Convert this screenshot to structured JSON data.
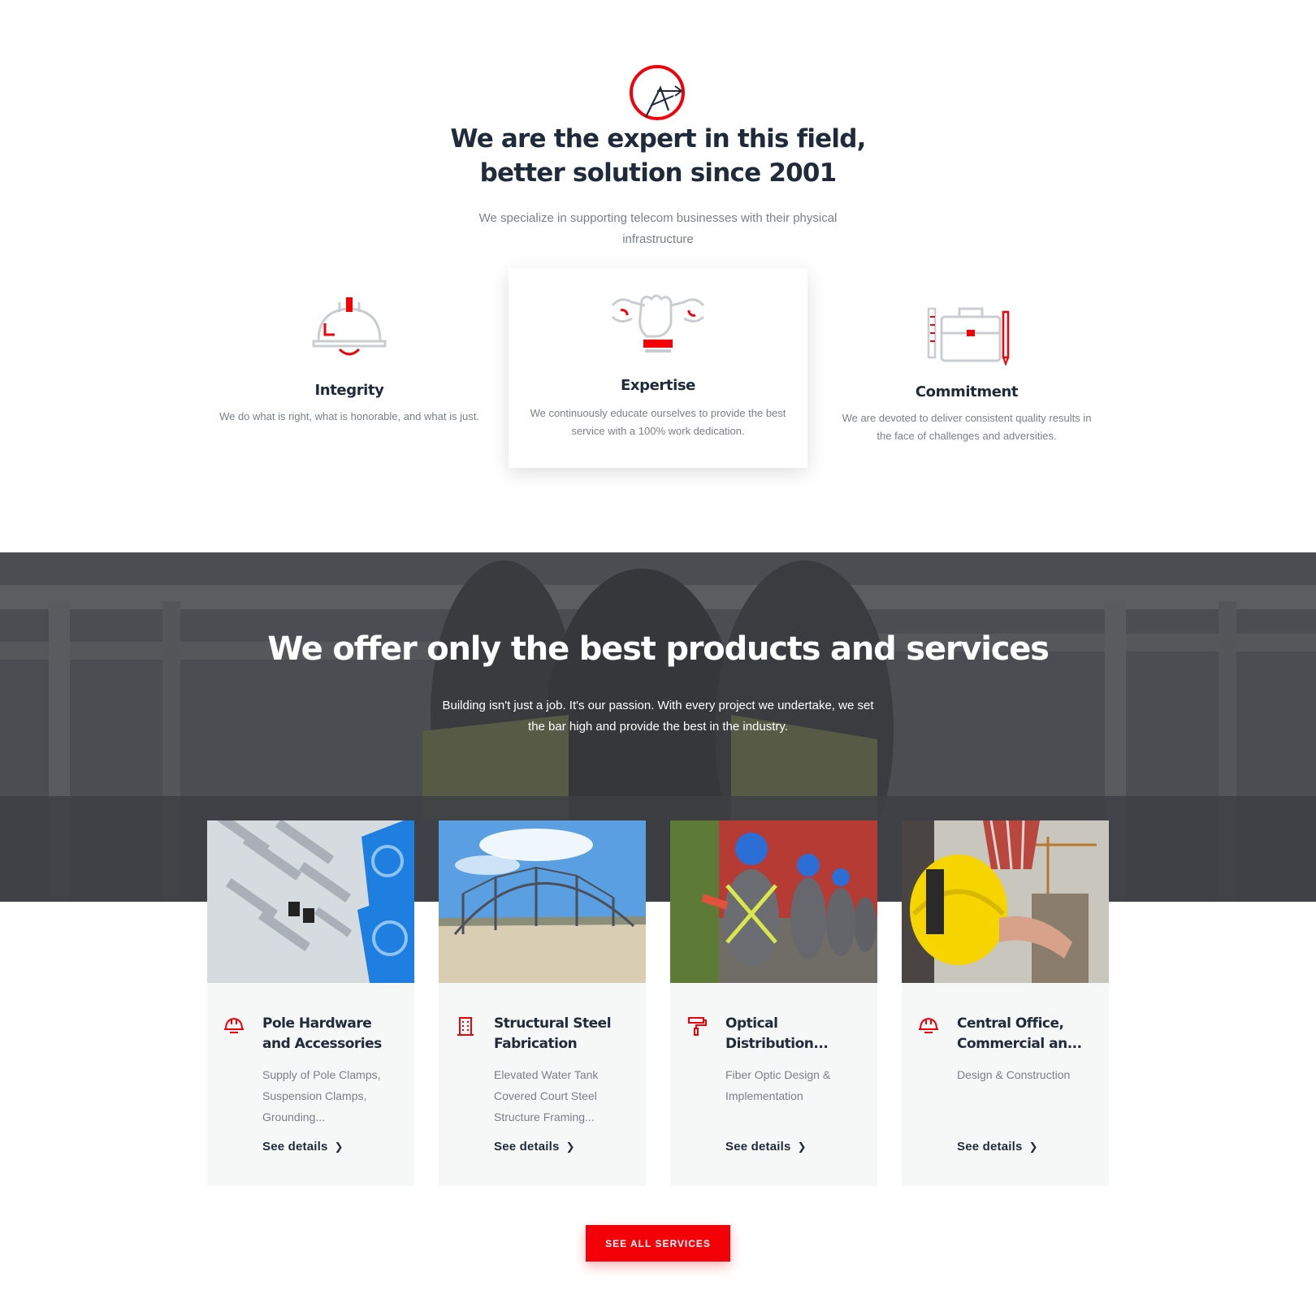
{
  "colors": {
    "accent": "#f40009",
    "heading": "#1f2b3a",
    "muted": "#7a7f87",
    "card_bg": "#f6f7f7"
  },
  "intro": {
    "headline_line1": "We are the expert in this field,",
    "headline_line2": "better solution since 2001",
    "text": "We specialize in supporting telecom businesses with their physical infrastructure"
  },
  "values": [
    {
      "icon": "hard-hat-icon",
      "title": "Integrity",
      "text": "We do what is right, what is honorable, and what is just."
    },
    {
      "icon": "wrench-fist-icon",
      "title": "Expertise",
      "text": "We continuously educate ourselves to provide the best service with a 100% work dedication."
    },
    {
      "icon": "briefcase-icon",
      "title": "Commitment",
      "text": "We are devoted to deliver consistent quality results in the face of challenges and adversities."
    }
  ],
  "services_band": {
    "title": "We offer only the best products and services",
    "text": "Building isn't just a job. It's our passion. With every project we undertake, we set the bar high and provide the best in the industry."
  },
  "services": [
    {
      "icon": "helmet-icon",
      "title": "Pole Hardware and Accessories",
      "desc": "Supply of Pole Clamps, Suspension Clamps, Grounding...",
      "link": "See details"
    },
    {
      "icon": "building-icon",
      "title": "Structural Steel Fabrication",
      "desc": "Elevated Water Tank Covered Court Steel Structure Framing...",
      "link": "See details"
    },
    {
      "icon": "paint-roller-icon",
      "title": "Optical Distribution...",
      "desc": "Fiber Optic Design & Implementation",
      "link": "See details"
    },
    {
      "icon": "helmet-icon",
      "title": "Central Office, Commercial an...",
      "desc": "Design & Construction",
      "link": "See details"
    }
  ],
  "cta": {
    "label": "SEE ALL SERVICES"
  }
}
